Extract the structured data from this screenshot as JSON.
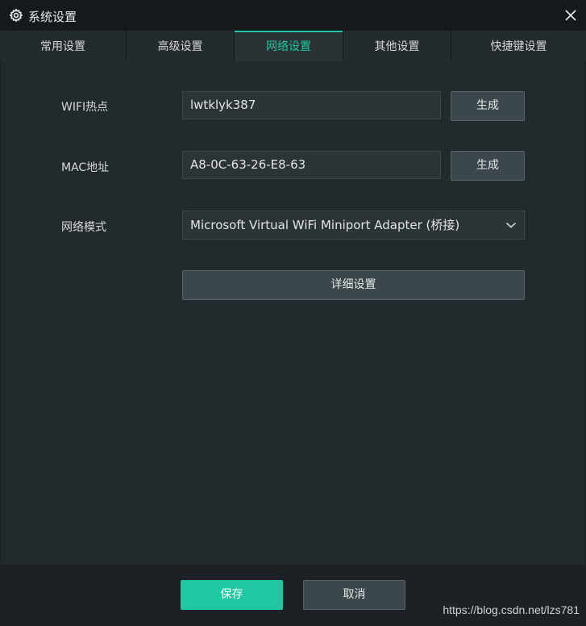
{
  "window": {
    "title": "系统设置",
    "icon": "gear-icon",
    "close_icon": "close-icon"
  },
  "tabs": [
    {
      "label": "常用设置",
      "active": false
    },
    {
      "label": "高级设置",
      "active": false
    },
    {
      "label": "网络设置",
      "active": true
    },
    {
      "label": "其他设置",
      "active": false
    },
    {
      "label": "快捷键设置",
      "active": false
    }
  ],
  "network": {
    "wifi": {
      "label": "WIFI热点",
      "value": "lwtklyk387",
      "button": "生成"
    },
    "mac": {
      "label": "MAC地址",
      "value": "A8-0C-63-26-E8-63",
      "button": "生成"
    },
    "mode": {
      "label": "网络模式",
      "selected": "Microsoft Virtual WiFi Miniport Adapter (桥接)"
    },
    "detail_button": "详细设置"
  },
  "footer": {
    "save": "保存",
    "cancel": "取消"
  },
  "watermark": "https://blog.csdn.net/lzs781",
  "colors": {
    "accent": "#1fc8a2",
    "background": "#222a2d",
    "titlebar": "#14191b"
  }
}
